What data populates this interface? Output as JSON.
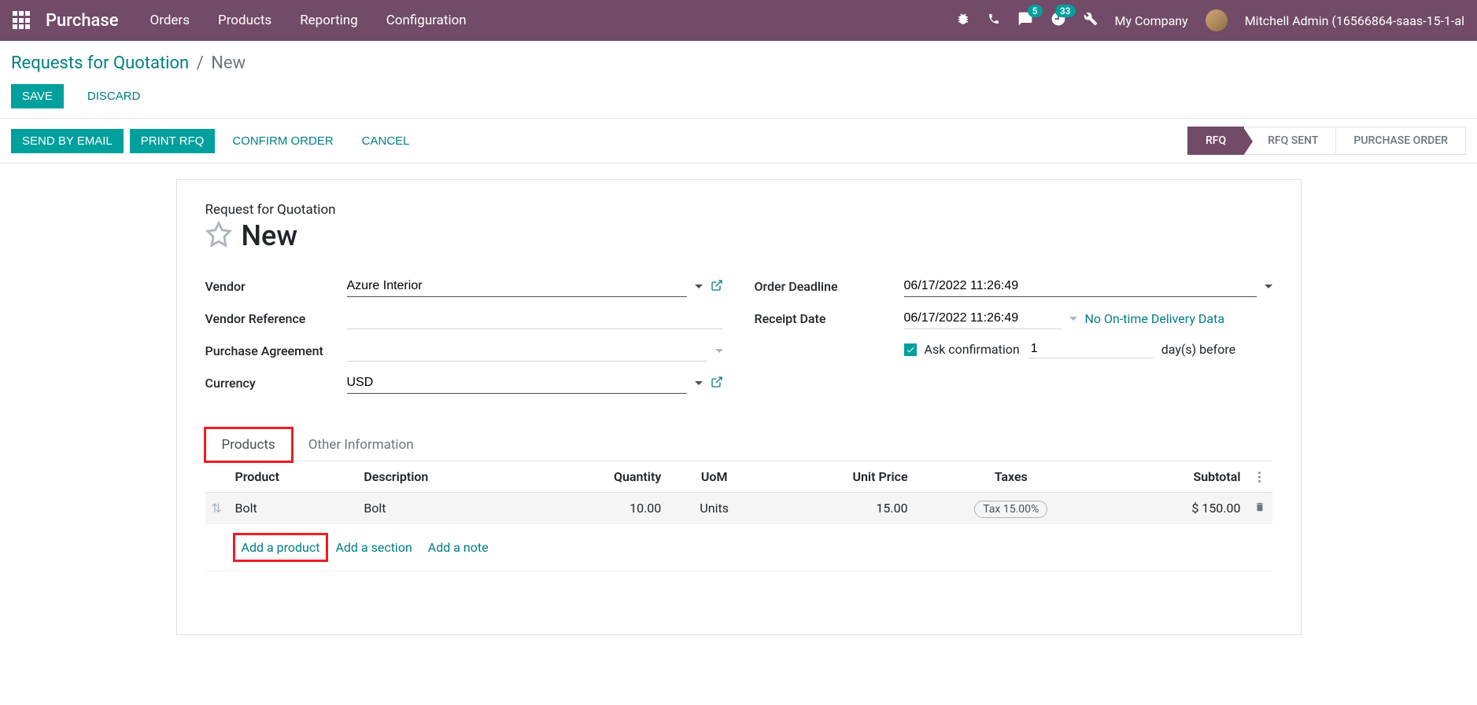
{
  "navbar": {
    "brand": "Purchase",
    "menu": [
      "Orders",
      "Products",
      "Reporting",
      "Configuration"
    ],
    "messages_badge": "5",
    "activities_badge": "33",
    "company": "My Company",
    "user": "Mitchell Admin (16566864-saas-15-1-al"
  },
  "breadcrumb": {
    "parent": "Requests for Quotation",
    "current": "New"
  },
  "controls": {
    "save": "SAVE",
    "discard": "DISCARD"
  },
  "statusbar": {
    "send_email": "SEND BY EMAIL",
    "print_rfq": "PRINT RFQ",
    "confirm": "CONFIRM ORDER",
    "cancel": "CANCEL",
    "stages": [
      {
        "label": "RFQ",
        "active": true
      },
      {
        "label": "RFQ SENT",
        "active": false
      },
      {
        "label": "PURCHASE ORDER",
        "active": false
      }
    ]
  },
  "form": {
    "subtitle": "Request for Quotation",
    "title": "New",
    "left": {
      "vendor_label": "Vendor",
      "vendor_value": "Azure Interior",
      "vendor_ref_label": "Vendor Reference",
      "vendor_ref_value": "",
      "agreement_label": "Purchase Agreement",
      "agreement_value": "",
      "currency_label": "Currency",
      "currency_value": "USD"
    },
    "right": {
      "deadline_label": "Order Deadline",
      "deadline_value": "06/17/2022 11:26:49",
      "receipt_label": "Receipt Date",
      "receipt_value": "06/17/2022 11:26:49",
      "no_delivery_data": "No On-time Delivery Data",
      "ask_confirm_label": "Ask confirmation",
      "ask_confirm_days": "1",
      "days_before": "day(s) before"
    }
  },
  "tabs": {
    "products": "Products",
    "other": "Other Information"
  },
  "table": {
    "headers": {
      "product": "Product",
      "description": "Description",
      "quantity": "Quantity",
      "uom": "UoM",
      "unit_price": "Unit Price",
      "taxes": "Taxes",
      "subtotal": "Subtotal"
    },
    "rows": [
      {
        "product": "Bolt",
        "description": "Bolt",
        "quantity": "10.00",
        "uom": "Units",
        "unit_price": "15.00",
        "tax": "Tax 15.00%",
        "subtotal": "$ 150.00"
      }
    ],
    "add_product": "Add a product",
    "add_section": "Add a section",
    "add_note": "Add a note"
  }
}
